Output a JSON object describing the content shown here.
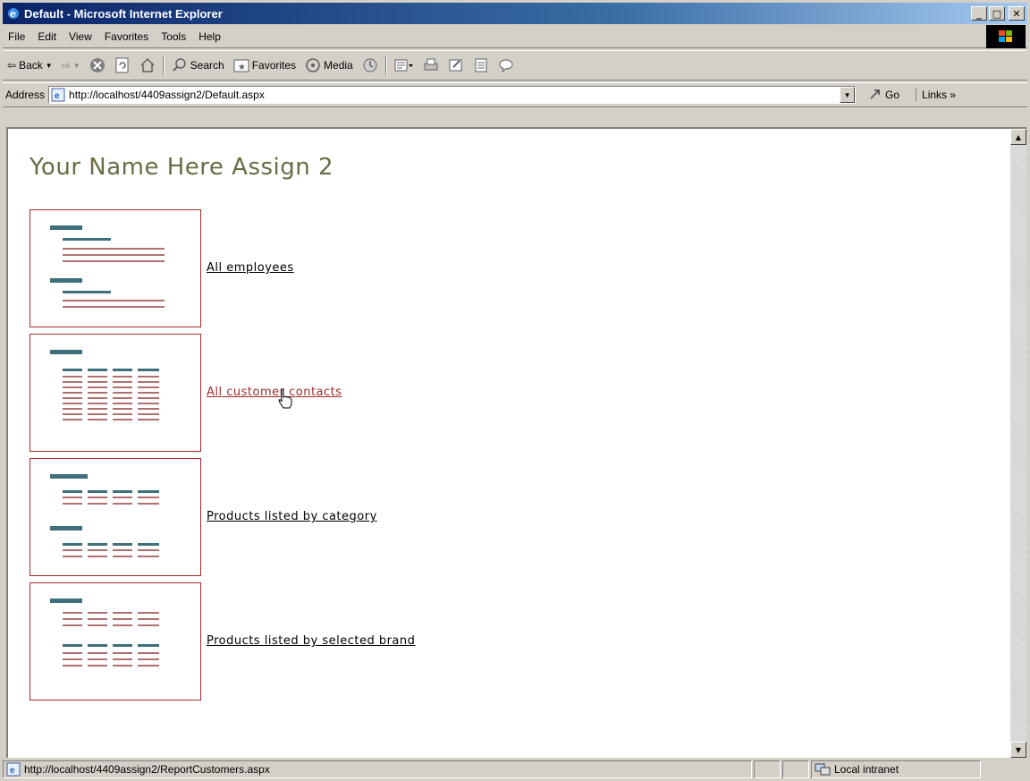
{
  "window": {
    "title": "Default - Microsoft Internet Explorer",
    "icon": "ie-icon"
  },
  "menu": {
    "items": [
      "File",
      "Edit",
      "View",
      "Favorites",
      "Tools",
      "Help"
    ]
  },
  "toolbar": {
    "back_label": "Back",
    "search_label": "Search",
    "favorites_label": "Favorites",
    "media_label": "Media"
  },
  "address": {
    "label": "Address",
    "url": "http://localhost/4409assign2/Default.aspx",
    "go_label": "Go",
    "links_label": "Links"
  },
  "page": {
    "title": "Your Name Here Assign 2",
    "reports": [
      {
        "label": "All employees",
        "thumbnail": "grouped-list"
      },
      {
        "label": "All customer contacts",
        "thumbnail": "table-columns"
      },
      {
        "label": "Products listed by category",
        "thumbnail": "grouped-table"
      },
      {
        "label": "Products listed by selected brand",
        "thumbnail": "grouped-table-alt"
      }
    ]
  },
  "status": {
    "text": "http://localhost/4409assign2/ReportCustomers.aspx",
    "zone": "Local intranet"
  },
  "colors": {
    "titlebar_start": "#0a246a",
    "link_hover": "#a52a2a",
    "title_text": "#6b6b44",
    "thumb_border": "#a52a2a",
    "thumb_header": "#3f6f7a",
    "thumb_line": "#b07070"
  }
}
